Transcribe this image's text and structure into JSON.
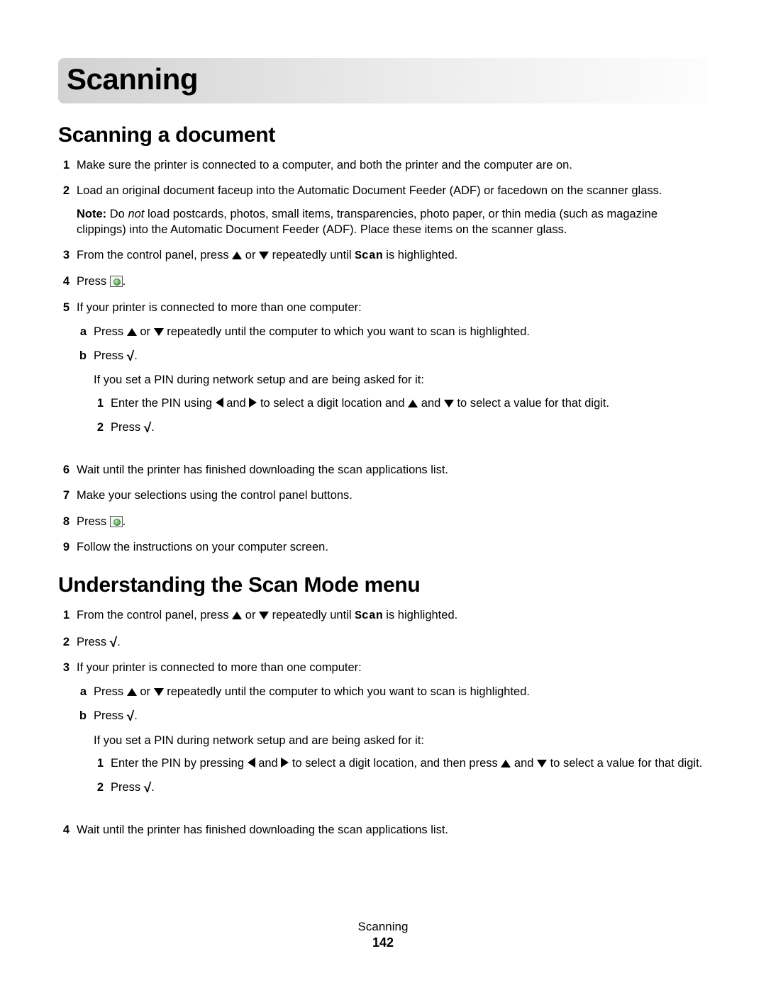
{
  "chapter_title": "Scanning",
  "section1": {
    "heading": "Scanning a document",
    "items": [
      {
        "n": "1",
        "text": "Make sure the printer is connected to a computer, and both the printer and the computer are on."
      },
      {
        "n": "2",
        "text": "Load an original document faceup into the Automatic Document Feeder (ADF) or facedown on the scanner glass.",
        "note_label": "Note:",
        "note_prefix": " Do ",
        "note_em": "not",
        "note_suffix": " load postcards, photos, small items, transparencies, photo paper, or thin media (such as magazine clippings) into the Automatic Document Feeder (ADF). Place these items on the scanner glass."
      },
      {
        "n": "3",
        "pre": "From the control panel, press ",
        "mid": " or ",
        "post": " repeatedly until ",
        "scan": "Scan",
        "tail": " is highlighted."
      },
      {
        "n": "4",
        "press": "Press "
      },
      {
        "n": "5",
        "text": "If your printer is connected to more than one computer:",
        "sub": [
          {
            "m": "a",
            "pre": "Press ",
            "mid": " or ",
            "post": " repeatedly until the computer to which you want to scan is highlighted."
          },
          {
            "m": "b",
            "press": "Press ",
            "pin_intro": "If you set a PIN during network setup and are being asked for it:",
            "pin_items": [
              {
                "n": "1",
                "pre": "Enter the PIN using ",
                "mid1": " and ",
                "mid2": " to select a digit location and ",
                "mid3": " and ",
                "post": " to select a value for that digit."
              },
              {
                "n": "2",
                "press": "Press "
              }
            ]
          }
        ]
      },
      {
        "n": "6",
        "text": "Wait until the printer has finished downloading the scan applications list."
      },
      {
        "n": "7",
        "text": "Make your selections using the control panel buttons."
      },
      {
        "n": "8",
        "press": "Press "
      },
      {
        "n": "9",
        "text": "Follow the instructions on your computer screen."
      }
    ]
  },
  "section2": {
    "heading": "Understanding the Scan Mode menu",
    "items": [
      {
        "n": "1",
        "pre": "From the control panel, press ",
        "mid": " or ",
        "post": " repeatedly until ",
        "scan": "Scan",
        "tail": " is highlighted."
      },
      {
        "n": "2",
        "press": "Press "
      },
      {
        "n": "3",
        "text": "If your printer is connected to more than one computer:",
        "sub": [
          {
            "m": "a",
            "pre": "Press ",
            "mid": " or ",
            "post": " repeatedly until the computer to which you want to scan is highlighted."
          },
          {
            "m": "b",
            "press": "Press ",
            "pin_intro": "If you set a PIN during network setup and are being asked for it:",
            "pin_items": [
              {
                "n": "1",
                "pre": "Enter the PIN by pressing ",
                "mid1": " and ",
                "mid2": " to select a digit location, and then press ",
                "mid3": " and ",
                "post": " to select a value for that digit."
              },
              {
                "n": "2",
                "press": "Press "
              }
            ]
          }
        ]
      },
      {
        "n": "4",
        "text": "Wait until the printer has finished downloading the scan applications list."
      }
    ]
  },
  "footer": {
    "section": "Scanning",
    "page": "142"
  },
  "period": "."
}
